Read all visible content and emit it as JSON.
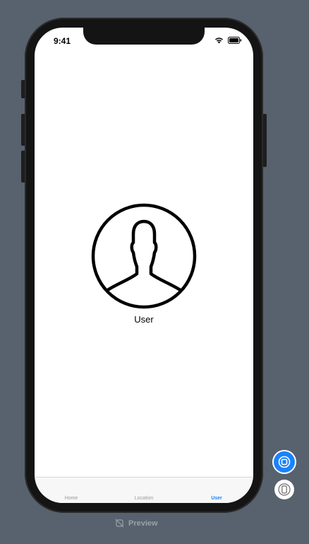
{
  "status_bar": {
    "time": "9:41",
    "icons": [
      "wifi-icon",
      "battery-icon"
    ]
  },
  "main": {
    "avatar_icon": "user-silhouette-icon",
    "label": "User"
  },
  "tabbar": {
    "tabs": [
      {
        "label": "Home",
        "selected": false
      },
      {
        "label": "Location",
        "selected": false
      },
      {
        "label": "User",
        "selected": true
      }
    ]
  },
  "canvas_controls": {
    "preview_label": "Preview",
    "live_button_icon": "live-preview-icon",
    "device_button_icon": "device-icon"
  },
  "colors": {
    "background": "#58616e",
    "accent": "#1a82fb",
    "tab_inactive": "#999999"
  }
}
